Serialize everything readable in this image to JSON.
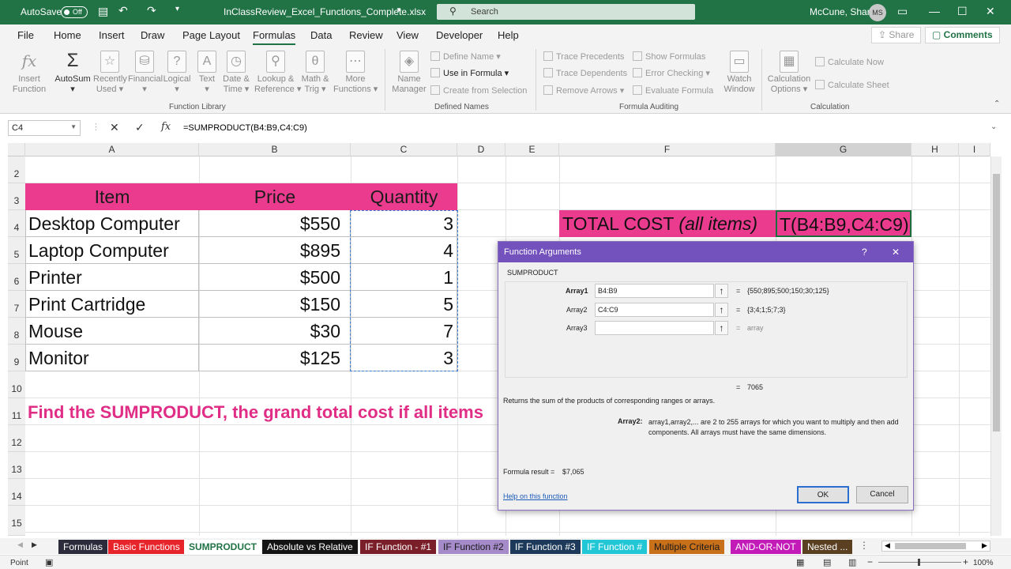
{
  "titlebar": {
    "autosave_label": "AutoSave",
    "autosave_state": "Off",
    "filename": "InClassReview_Excel_Functions_Complete.xlsx",
    "search_placeholder": "Search",
    "user_name": "McCune, Sharla",
    "user_initials": "MS"
  },
  "menu": {
    "tabs": [
      "File",
      "Home",
      "Insert",
      "Draw",
      "Page Layout",
      "Formulas",
      "Data",
      "Review",
      "View",
      "Developer",
      "Help"
    ],
    "active": "Formulas",
    "share_label": "Share",
    "comments_label": "Comments"
  },
  "ribbon": {
    "insert_function": [
      "Insert",
      "Function"
    ],
    "autosum": "AutoSum",
    "recently_used": [
      "Recently",
      "Used"
    ],
    "financial": "Financial",
    "logical": "Logical",
    "text": "Text",
    "date_time": [
      "Date &",
      "Time"
    ],
    "lookup_reference": [
      "Lookup &",
      "Reference"
    ],
    "math_trig": [
      "Math &",
      "Trig"
    ],
    "more_functions": [
      "More",
      "Functions"
    ],
    "function_library_label": "Function Library",
    "name_manager": [
      "Name",
      "Manager"
    ],
    "define_name": "Define Name",
    "use_in_formula": "Use in Formula",
    "create_from_selection": "Create from Selection",
    "defined_names_label": "Defined Names",
    "trace_precedents": "Trace Precedents",
    "trace_dependents": "Trace Dependents",
    "remove_arrows": "Remove Arrows",
    "show_formulas": "Show Formulas",
    "error_checking": "Error Checking",
    "evaluate_formula": "Evaluate Formula",
    "watch_window": [
      "Watch",
      "Window"
    ],
    "formula_auditing_label": "Formula Auditing",
    "calculation_options": [
      "Calculation",
      "Options"
    ],
    "calculate_now": "Calculate Now",
    "calculate_sheet": "Calculate Sheet",
    "calculation_label": "Calculation"
  },
  "formula_bar": {
    "name_box": "C4",
    "formula": "=SUMPRODUCT(B4:B9,C4:C9)"
  },
  "grid": {
    "columns": [
      "A",
      "B",
      "C",
      "D",
      "E",
      "F",
      "G",
      "H",
      "I"
    ],
    "rows": [
      "2",
      "3",
      "4",
      "5",
      "6",
      "7",
      "8",
      "9",
      "10",
      "11",
      "12",
      "13",
      "14",
      "15"
    ],
    "headers": [
      "Item",
      "Price",
      "Quantity"
    ],
    "items": [
      {
        "item": "Desktop Computer",
        "price": "$550",
        "qty": "3"
      },
      {
        "item": "Laptop Computer",
        "price": "$895",
        "qty": "4"
      },
      {
        "item": "Printer",
        "price": "$500",
        "qty": "1"
      },
      {
        "item": "Print Cartridge",
        "price": "$150",
        "qty": "5"
      },
      {
        "item": "Mouse",
        "price": "$30",
        "qty": "7"
      },
      {
        "item": "Monitor",
        "price": "$125",
        "qty": "3"
      }
    ],
    "total_label": "TOTAL COST ",
    "total_label_italic": "(all items)",
    "total_cell": "T(B4:B9,C4:C9)",
    "instruction": "Find the SUMPRODUCT, the grand total cost if all items"
  },
  "dialog": {
    "title": "Function Arguments",
    "help_glyph": "?",
    "close_glyph": "✕",
    "function_name": "SUMPRODUCT",
    "args": [
      {
        "label": "Array1",
        "value": "B4:B9",
        "result": "{550;895;500;150;30;125}"
      },
      {
        "label": "Array2",
        "value": "C4:C9",
        "result": "{3;4;1;5;7;3}"
      },
      {
        "label": "Array3",
        "value": "",
        "result": "array"
      }
    ],
    "eq": "=",
    "total_result": "7065",
    "description": "Returns the sum of the products of corresponding ranges or arrays.",
    "arg_help_label": "Array2:",
    "arg_help_text": "array1,array2,... are 2 to 255 arrays for which you want to multiply and then add components. All arrays must have the same dimensions.",
    "formula_result_label": "Formula result =",
    "formula_result_value": "$7,065",
    "help_link": "Help on this function",
    "ok_label": "OK",
    "cancel_label": "Cancel"
  },
  "sheet_tabs": [
    {
      "label": "Formulas",
      "bg": "#2b2b3b",
      "fg": "#ffffff"
    },
    {
      "label": "Basic Functions",
      "bg": "#e8242b",
      "fg": "#ffffff"
    },
    {
      "label": "SUMPRODUCT",
      "bg": "#ffffff",
      "fg": "#217346"
    },
    {
      "label": "Absolute vs Relative",
      "bg": "#141414",
      "fg": "#ffffff"
    },
    {
      "label": "IF Function - #1",
      "bg": "#7a1f2a",
      "fg": "#ffffff"
    },
    {
      "label": "IF Function #2",
      "bg": "#a58bc9",
      "fg": "#1a1a1a"
    },
    {
      "label": "IF Function #3",
      "bg": "#1d3a5a",
      "fg": "#ffffff"
    },
    {
      "label": "IF Function #",
      "bg": "#22c7d6",
      "fg": "#ffffff"
    },
    {
      "label": "Multiple Criteria",
      "bg": "#c8701a",
      "fg": "#1a1a1a"
    },
    {
      "label": "AND-OR-NOT",
      "bg": "#c21bb8",
      "fg": "#ffffff"
    },
    {
      "label": "Nested ...",
      "bg": "#5a4020",
      "fg": "#ffffff"
    }
  ],
  "status": {
    "mode": "Point",
    "zoom": "100%"
  },
  "colors": {
    "excel_green": "#217346",
    "header_pink": "#ea3b8f",
    "dialog_purple": "#7352bd",
    "instruction_pink": "#e02d86"
  }
}
